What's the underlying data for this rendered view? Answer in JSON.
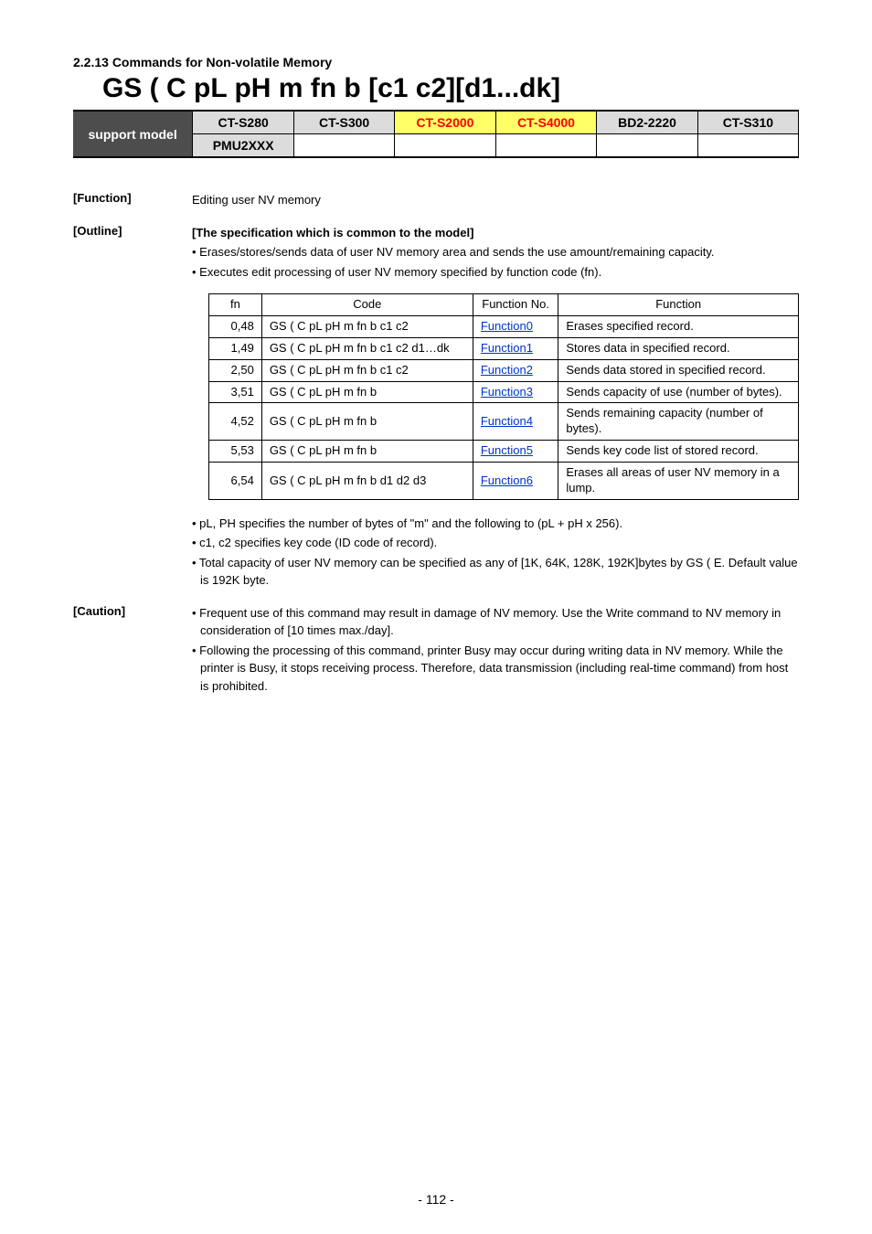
{
  "section_heading": "2.2.13 Commands for Non-volatile Memory",
  "title": "GS ( C pL pH m fn b [c1 c2][d1...dk]",
  "support_label": "support model",
  "models": {
    "r1c1": "CT-S280",
    "r1c2": "CT-S300",
    "r1c3": "CT-S2000",
    "r1c4": "CT-S4000",
    "r1c5": "BD2-2220",
    "r1c6": "CT-S310",
    "r2c1": "PMU2XXX"
  },
  "function": {
    "label": "[Function]",
    "text": "Editing user NV memory"
  },
  "outline": {
    "label": "[Outline]",
    "heading": "[The specification which is common to the model]",
    "bullets": [
      "• Erases/stores/sends data of user NV memory area and sends the use amount/remaining capacity.",
      "• Executes edit processing of user NV memory specified by function code (fn)."
    ]
  },
  "table": {
    "headers": {
      "fn": "fn",
      "code": "Code",
      "fno": "Function No.",
      "func": "Function"
    },
    "rows": [
      {
        "fn": "0,48",
        "code": "GS ( C pL pH m fn b c1 c2",
        "fno": "Function0",
        "func": "Erases specified record."
      },
      {
        "fn": "1,49",
        "code": "GS ( C pL pH m fn b c1 c2 d1…dk",
        "fno": "Function1",
        "func": "Stores data in specified record."
      },
      {
        "fn": "2,50",
        "code": "GS ( C pL pH m fn b c1 c2",
        "fno": "Function2",
        "func": "Sends data stored in specified record."
      },
      {
        "fn": "3,51",
        "code": "GS ( C pL pH m fn b",
        "fno": "Function3",
        "func": "Sends capacity of use (number of bytes)."
      },
      {
        "fn": "4,52",
        "code": "GS ( C pL pH m fn b",
        "fno": "Function4",
        "func": "Sends remaining capacity (number of bytes)."
      },
      {
        "fn": "5,53",
        "code": "GS ( C pL pH m fn b",
        "fno": "Function5",
        "func": "Sends key code list of stored record."
      },
      {
        "fn": "6,54",
        "code": "GS ( C pL pH m fn b d1 d2 d3",
        "fno": "Function6",
        "func": "Erases all areas of user NV memory in a lump."
      }
    ]
  },
  "outline_after": [
    "• pL, PH specifies the number of bytes of \"m\" and the following to (pL + pH x 256).",
    "• c1, c2 specifies key code (ID code of record).",
    "• Total capacity of user NV memory can be specified as any of [1K, 64K, 128K, 192K]bytes by GS ( E. Default value is 192K byte."
  ],
  "caution": {
    "label": "[Caution]",
    "bullets": [
      "• Frequent use of this command may result in damage of NV memory. Use the Write command to NV memory in consideration of [10 times max./day].",
      "• Following the processing of this command, printer Busy may occur during writing data in NV memory. While the printer is Busy, it stops receiving process. Therefore, data transmission (including real-time command) from host is prohibited."
    ]
  },
  "page_number": "- 112 -"
}
